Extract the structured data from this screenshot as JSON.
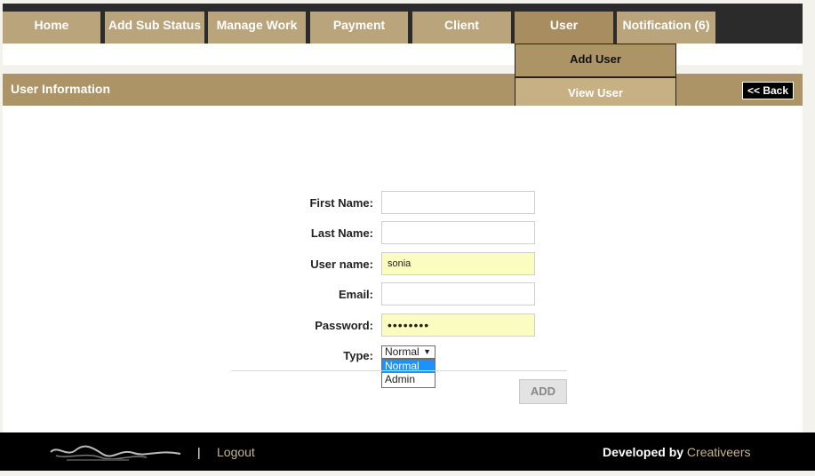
{
  "nav": {
    "tabs": [
      {
        "label": "Home"
      },
      {
        "label": "Add Sub Status"
      },
      {
        "label": "Manage Work"
      },
      {
        "label": "Payment"
      },
      {
        "label": "Client"
      },
      {
        "label": "User"
      },
      {
        "label": "Notification (6)"
      }
    ],
    "user_menu": {
      "add_user": "Add User",
      "view_user": "View User"
    }
  },
  "header": {
    "title": "User Information",
    "back_label": "<< Back"
  },
  "form": {
    "first_name_label": "First Name:",
    "first_name_value": "",
    "last_name_label": "Last Name:",
    "last_name_value": "",
    "username_label": "User name:",
    "username_value": "sonia",
    "email_label": "Email:",
    "email_value": "",
    "password_label": "Password:",
    "password_value": "••••••••",
    "type_label": "Type:",
    "type_selected": "Normal",
    "type_options": [
      "Normal",
      "Admin"
    ],
    "add_label": "ADD"
  },
  "footer": {
    "separator": "|",
    "logout_label": "Logout",
    "developed_by_label": "Developed by",
    "developer_name": "Creativeers"
  },
  "colors": {
    "accent": "#ac9466",
    "tab": "#baa47c",
    "highlight_field": "#fbfcc0",
    "footer_link": "#c9b48f"
  },
  "icons": {
    "dropdown_arrow": "triangle-down-icon",
    "footer_logo": "company-logo"
  }
}
